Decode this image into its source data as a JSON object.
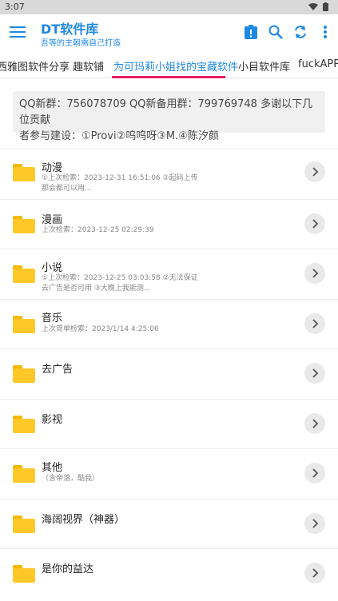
{
  "status_bar": {
    "time": "3:07"
  },
  "header": {
    "title": "DT软件库",
    "subtitle": "吾等的主朝需自己打造",
    "icons": [
      "menu-icon",
      "alert-icon",
      "search-icon",
      "refresh-icon",
      "more-vert-icon"
    ]
  },
  "tabs": [
    {
      "label": "西雅图软件分享",
      "active": false
    },
    {
      "label": "趣软铺",
      "active": false
    },
    {
      "label": "为可玛莉小姐找的宝藏软件",
      "active": true
    },
    {
      "label": "小目软件库",
      "active": false
    },
    {
      "label": "fuckAPP",
      "active": false
    }
  ],
  "notice": {
    "line1": "QQ新群：756078709 QQ新备用群：799769748 多谢以下几位贡献",
    "line2": "者参与建设：①Provi②呜呜呀③M.④陈汐颜"
  },
  "items": [
    {
      "title": "动漫",
      "desc1": "①上次检索：2023-12-31 16:51:06 ②起码上传",
      "desc2": "那会都可以用..."
    },
    {
      "title": "漫画",
      "desc1": "上次检索：2023-12-25 02:29:39",
      "desc2": ""
    },
    {
      "title": "小说",
      "desc1": "①上次检索：2023-12-25 03:03:58 ②无法保证",
      "desc2": "去广告是否可用 ③大晚上我能测..."
    },
    {
      "title": "音乐",
      "desc1": "上次简单检索：2023/1/14 4:25:06",
      "desc2": ""
    },
    {
      "title": "去广告",
      "desc1": "",
      "desc2": ""
    },
    {
      "title": "影视",
      "desc1": "",
      "desc2": ""
    },
    {
      "title": "其他",
      "desc1": "（含帝落，酷我）",
      "desc2": ""
    },
    {
      "title": "海阔视界（神器）",
      "desc1": "",
      "desc2": ""
    },
    {
      "title": "是你的益达",
      "desc1": "",
      "desc2": ""
    }
  ],
  "colors": {
    "accent": "#1e88e5",
    "indicator": "#e91e63",
    "folder": "#ffc828"
  }
}
